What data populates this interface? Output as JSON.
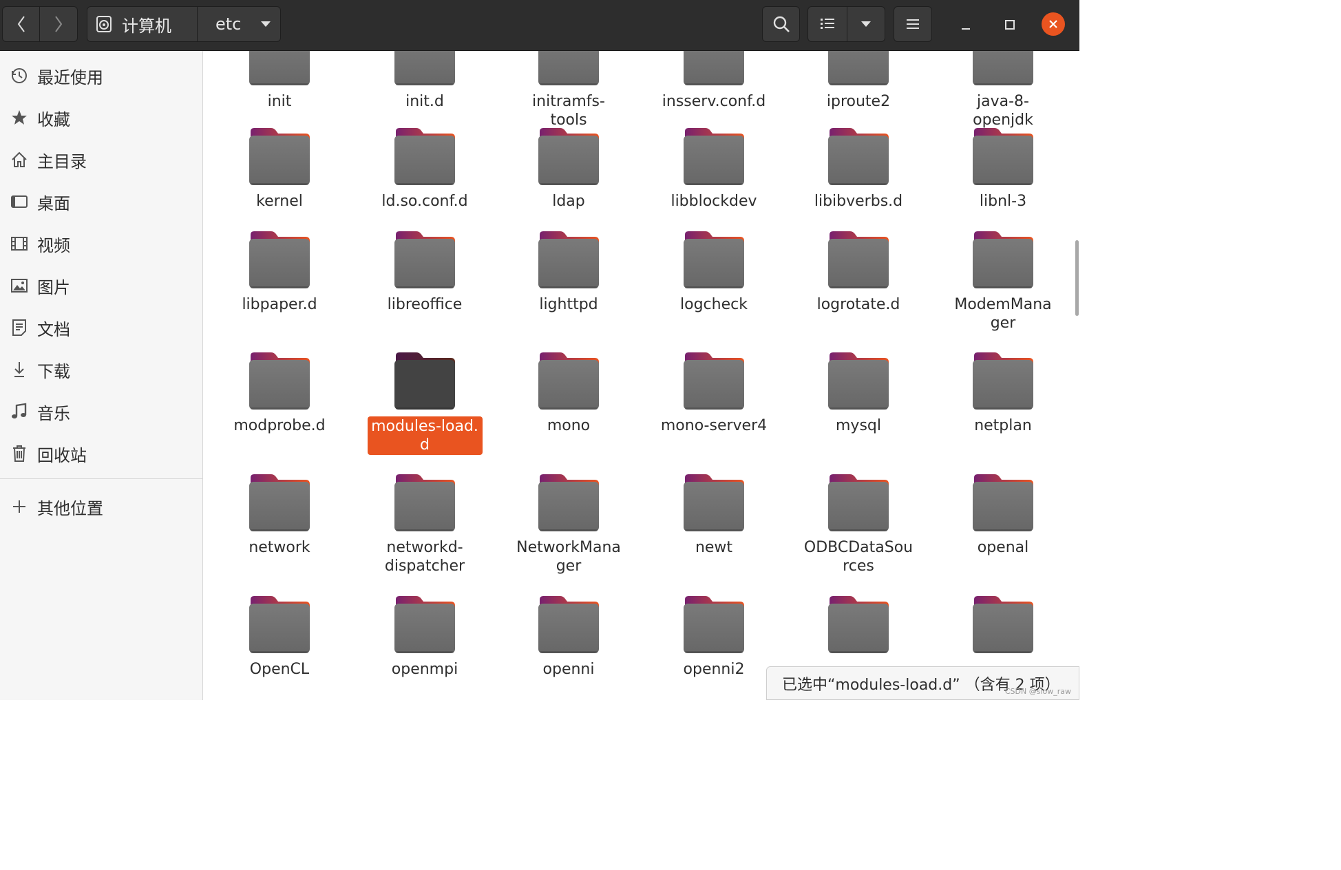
{
  "header": {
    "back_icon": "chevron-left-icon",
    "forward_icon": "chevron-right-icon",
    "path": [
      {
        "label": "计算机",
        "icon": "disk-icon"
      },
      {
        "label": "etc"
      }
    ],
    "search_icon": "search-icon",
    "view_icon": "list-view-icon",
    "view_dropdown_icon": "dropdown-icon",
    "menu_icon": "hamburger-icon",
    "minimize_icon": "minimize-icon",
    "maximize_icon": "maximize-icon",
    "close_icon": "close-icon",
    "close_color": "#e95420"
  },
  "sidebar": {
    "items": [
      {
        "label": "最近使用",
        "icon": "clock-icon"
      },
      {
        "label": "收藏",
        "icon": "star-icon"
      },
      {
        "label": "主目录",
        "icon": "home-icon"
      },
      {
        "label": "桌面",
        "icon": "desktop-icon"
      },
      {
        "label": "视频",
        "icon": "film-icon"
      },
      {
        "label": "图片",
        "icon": "image-icon"
      },
      {
        "label": "文档",
        "icon": "document-icon"
      },
      {
        "label": "下载",
        "icon": "download-icon"
      },
      {
        "label": "音乐",
        "icon": "music-icon"
      },
      {
        "label": "回收站",
        "icon": "trash-icon"
      }
    ],
    "other": {
      "label": "其他位置",
      "icon": "plus-icon"
    }
  },
  "files": {
    "row0": [
      "init",
      "init.d",
      "initramfs-\ntools",
      "insserv.conf.d",
      "iproute2",
      "java-8-\nopenjdk"
    ],
    "row1": [
      "kernel",
      "ld.so.conf.d",
      "ldap",
      "libblockdev",
      "libibverbs.d",
      "libnl-3"
    ],
    "row2": [
      "libpaper.d",
      "libreoffice",
      "lighttpd",
      "logcheck",
      "logrotate.d",
      "ModemMana\nger"
    ],
    "row3": [
      "modprobe.d",
      "modules-load.\nd",
      "mono",
      "mono-server4",
      "mysql",
      "netplan"
    ],
    "row4": [
      "network",
      "networkd-\ndispatcher",
      "NetworkMana\nger",
      "newt",
      "ODBCDataSou\nrces",
      "openal"
    ],
    "row5": [
      "OpenCL",
      "openmpi",
      "openni",
      "openni2",
      "",
      ""
    ],
    "selected": "modules-load.d"
  },
  "status": {
    "text": "已选中“modules-load.d” （含有 2 项）",
    "watermark": "CSDN @slow_raw"
  },
  "colors": {
    "accent": "#e95420",
    "folder_body": "#6e6e6e",
    "folder_tab_top": "#77216f",
    "folder_tab_bottom": "#e95420"
  }
}
